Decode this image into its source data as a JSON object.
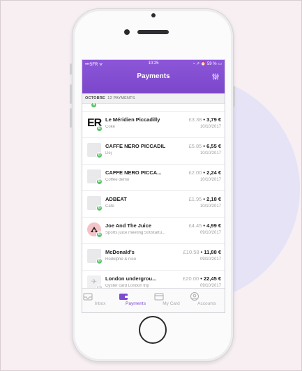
{
  "status": {
    "carrier": "SFR",
    "time": "10:25",
    "battery": "59 %"
  },
  "header": {
    "title": "Payments"
  },
  "section": {
    "month": "OCTOBRE",
    "count": "12 PAYMENTS"
  },
  "payments": [
    {
      "merchant": "Le Méridien Piccadilly",
      "note": "Coke",
      "gbp": "£3.38",
      "eur": "3,79 €",
      "date": "10/10/2017",
      "avatar_text": "ER",
      "badge": "B"
    },
    {
      "merchant": "CAFFE NERO PICCADIL",
      "note": "Dej",
      "gbp": "£5.85",
      "eur": "6,55 €",
      "date": "10/10/2017",
      "badge": "B"
    },
    {
      "merchant": "CAFFE NERO PICCA...",
      "note": "Coffee demo",
      "gbp": "£2.00",
      "eur": "2,24 €",
      "date": "10/10/2017",
      "badge": "B"
    },
    {
      "merchant": "ADBEAT",
      "note": "Cafe",
      "gbp": "£1.95",
      "eur": "2,18 €",
      "date": "10/10/2017",
      "badge": "B"
    },
    {
      "merchant": "Joe And The Juice",
      "note": "Sports juice meeting 500startu...",
      "gbp": "£4.45",
      "eur": "4,99 €",
      "date": "09/10/2017",
      "badge": "B"
    },
    {
      "merchant": "McDonald's",
      "note": "Rodolphe & nico",
      "gbp": "£10.58",
      "eur": "11,88 €",
      "date": "09/10/2017",
      "badge": "B"
    },
    {
      "merchant": "London undergrou...",
      "note": "Oyster card London trip",
      "gbp": "£20.00",
      "eur": "22,45 €",
      "date": "09/10/2017",
      "badge": "B"
    }
  ],
  "tabs": [
    {
      "label": "Inbox",
      "icon": "inbox-icon"
    },
    {
      "label": "Payments",
      "icon": "wallet-icon"
    },
    {
      "label": "My Card",
      "icon": "card-icon"
    },
    {
      "label": "Accounts",
      "icon": "user-icon"
    }
  ],
  "colors": {
    "accent": "#7e4bd0",
    "badge_green": "#59c469",
    "halo": "#e6e3f7"
  }
}
